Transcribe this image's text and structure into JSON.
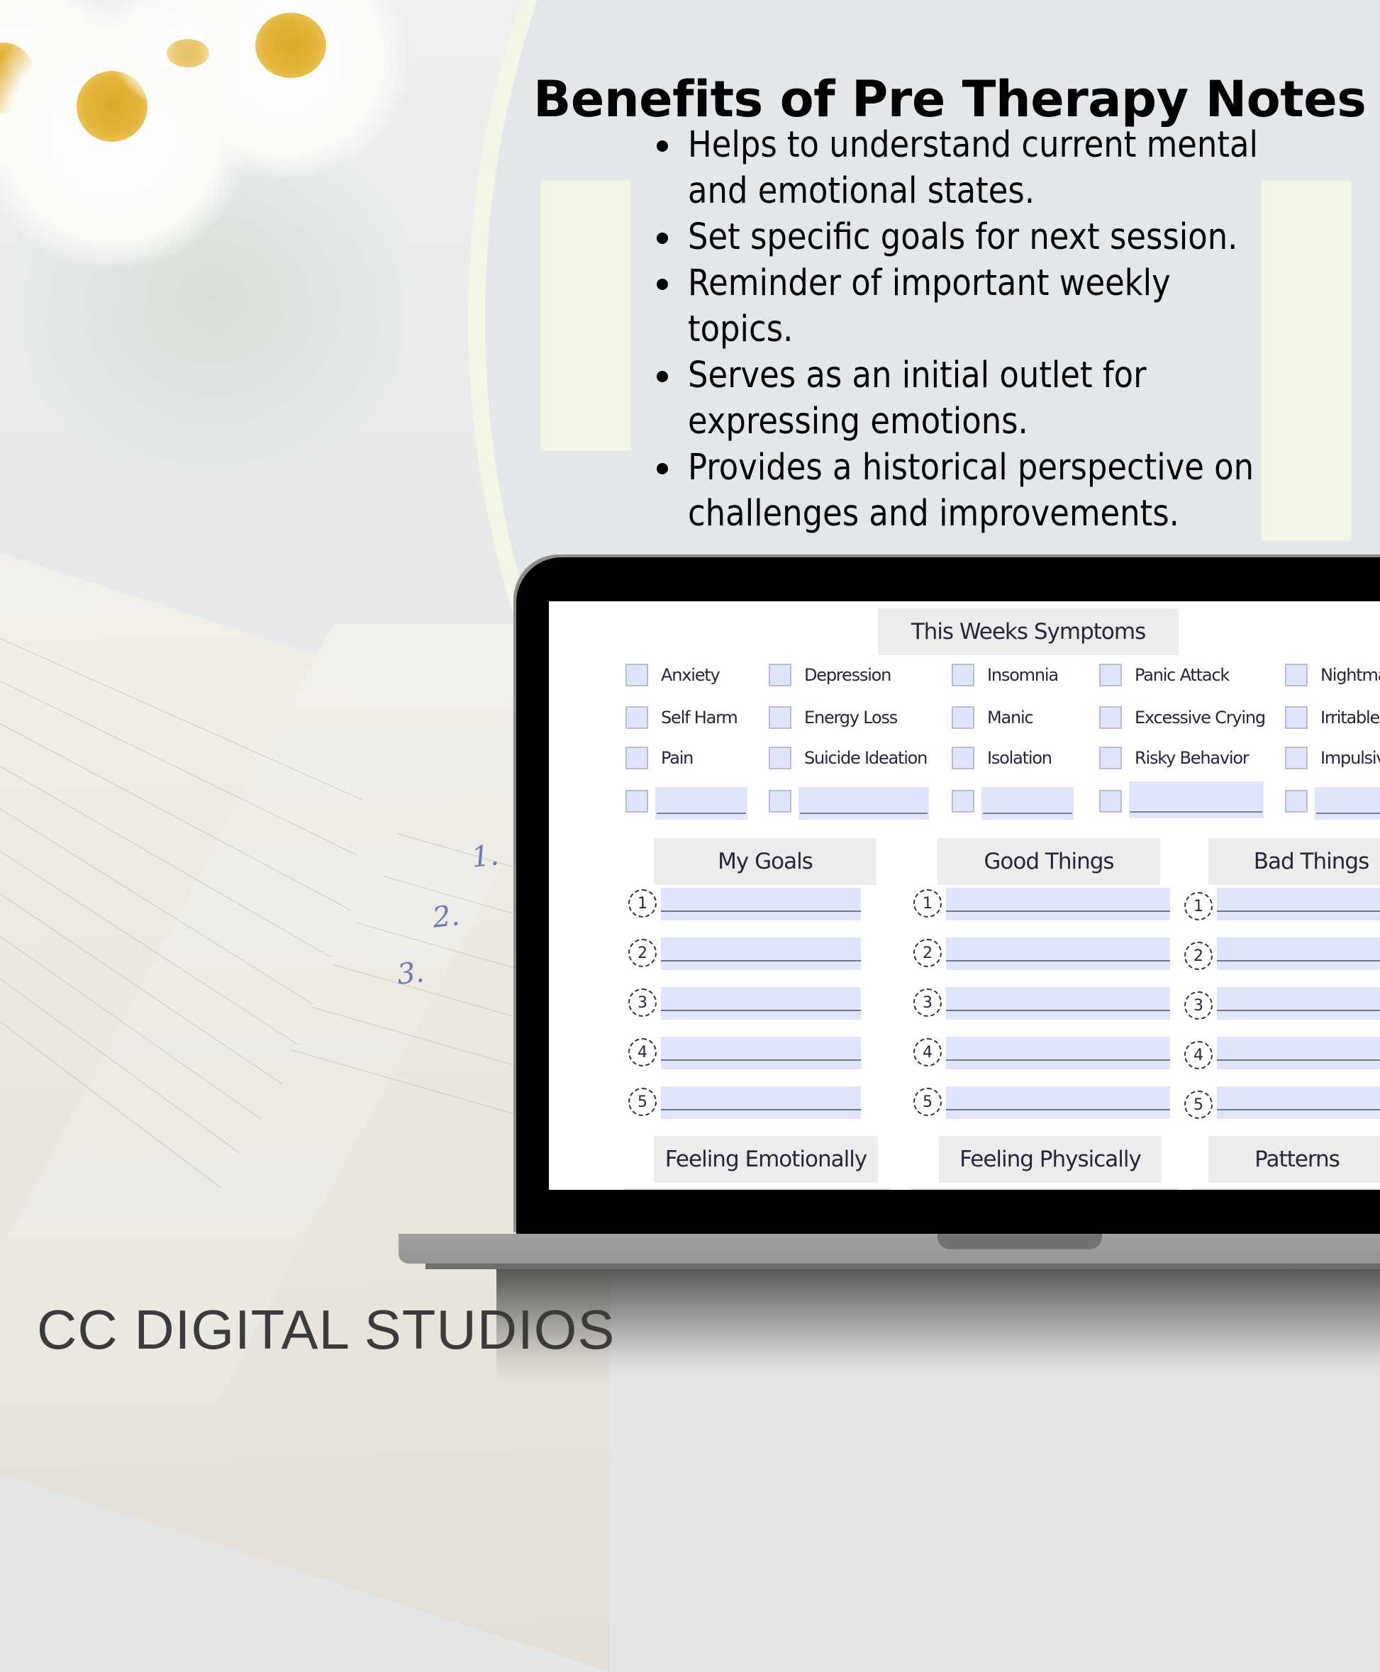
{
  "title": "Benefits of Pre Therapy Notes",
  "benefits": [
    "Helps to understand current mental",
    "and emotional states.",
    "Set specific goals for next session.",
    "Reminder of important weekly",
    "topics.",
    "Serves as an initial outlet for",
    "expressing emotions.",
    "Provides a historical perspective on",
    "challenges and improvements."
  ],
  "benefit_items": [
    "Helps to understand current mental and emotional states.",
    "Set specific goals for next session.",
    "Reminder of important weekly topics.",
    "Serves as an initial outlet for expressing emotions.",
    "Provides a historical perspective on challenges and improvements."
  ],
  "background": {
    "notebook_numbers": [
      "1.",
      "2.",
      "3."
    ]
  },
  "screen": {
    "symptoms_header": "This Weeks Symptoms",
    "symptoms": [
      [
        "Anxiety",
        "Depression",
        "Insomnia",
        "Panic Attack",
        "Nightma"
      ],
      [
        "Self Harm",
        "Energy Loss",
        "Manic",
        "Excessive Crying",
        "Irritable"
      ],
      [
        "Pain",
        "Suicide Ideation",
        "Isolation",
        "Risky Behavior",
        "Impulsive"
      ]
    ],
    "lists": [
      {
        "header": "My Goals",
        "numbers": [
          "1",
          "2",
          "3",
          "4",
          "5"
        ]
      },
      {
        "header": "Good Things",
        "numbers": [
          "1",
          "2",
          "3",
          "4",
          "5"
        ]
      },
      {
        "header": "Bad Things",
        "numbers": [
          "1",
          "2",
          "3",
          "4",
          "5"
        ]
      }
    ],
    "bottom_headers": [
      "Feeling Emotionally",
      "Feeling Physically",
      "Patterns"
    ],
    "colors": {
      "field_fill": "#e0e4fb",
      "header_fill": "#ececec"
    }
  },
  "brand": "CC DIGITAL STUDIOS"
}
